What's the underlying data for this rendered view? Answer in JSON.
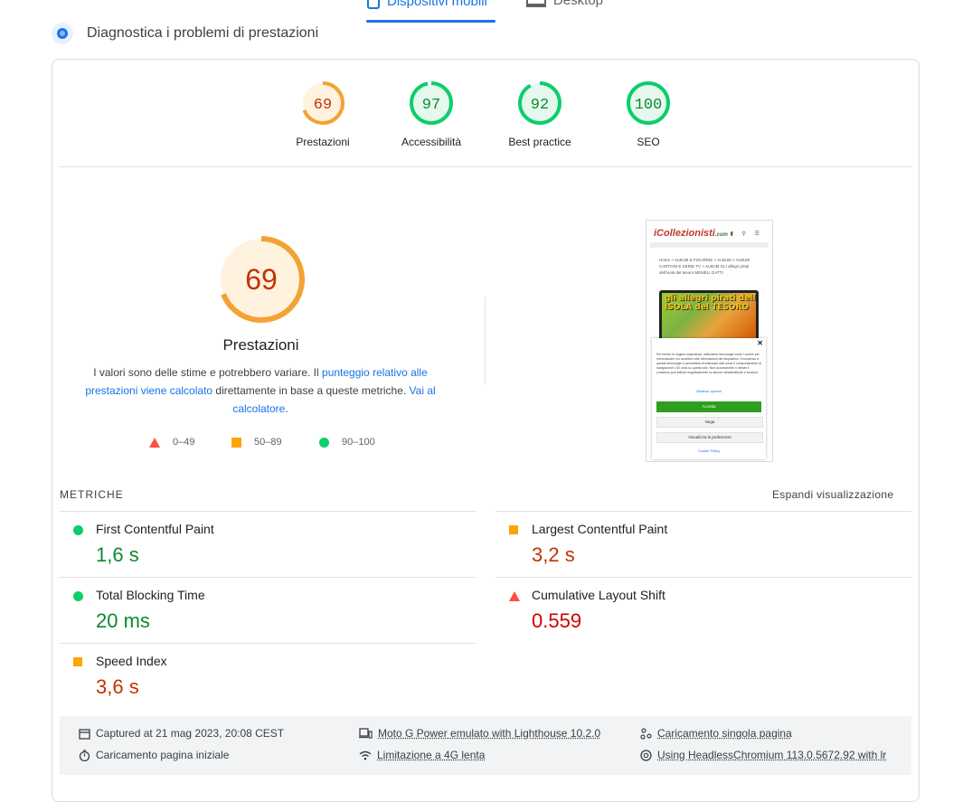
{
  "tabs": {
    "mobile_label": "Dispositivi mobili",
    "desktop_label": "Desktop"
  },
  "diagnostics": {
    "title": "Diagnostica i problemi di prestazioni"
  },
  "gauges": [
    {
      "score": "69",
      "label": "Prestazioni",
      "level": 0.69,
      "color": "#f4a233",
      "text_color": "#c33300",
      "bg": "#fff3e0"
    },
    {
      "score": "97",
      "label": "Accessibilità",
      "level": 0.97,
      "color": "#0cce6b",
      "text_color": "#0d8a2d",
      "bg": "#e6f8ee"
    },
    {
      "score": "92",
      "label": "Best practice",
      "level": 0.92,
      "color": "#0cce6b",
      "text_color": "#0d8a2d",
      "bg": "#e6f8ee"
    },
    {
      "score": "100",
      "label": "SEO",
      "level": 1.0,
      "color": "#0cce6b",
      "text_color": "#0d8a2d",
      "bg": "#e6f8ee"
    }
  ],
  "performance": {
    "score": "69",
    "level": 0.69,
    "title": "Prestazioni",
    "desc_1": "I valori sono delle stime e potrebbero variare. Il ",
    "desc_link_1": "punteggio relativo alle prestazioni viene calcolato",
    "desc_2": " direttamente in base a queste metriche. ",
    "desc_link_2": "Vai al calcolatore",
    "desc_3": "."
  },
  "legend": {
    "bad": "0–49",
    "average": "50–89",
    "good": "90–100"
  },
  "screenshot": {
    "logo_main": "iCollezionisti",
    "logo_suffix": ".com",
    "breadcrumb": "Home > ALBUM & FIGURINE > ALBUM > ALBUM CARTONI E SERIE TV > ALBUM GLI allegri pirati dell'isola del tesoro MEMELI GATTI",
    "image_text": "gli allegri pirati dell ISOLA del TESORO",
    "cookie_text": "Per fornire le migliori esperienze, utilizziamo tecnologie come i cookie per memorizzare e/o accedere alle informazioni del dispositivo. Il consenso a queste tecnologie ci permetterà di elaborare dati come il comportamento di navigazione o ID unici su questo sito. Non acconsentire o ritirare il consenso può influire negativamente su alcune caratteristiche e funzioni.",
    "manage_link": "Gestisci opzioni",
    "accept": "Accetta",
    "deny": "Nega",
    "preferences": "Visualizza le preferenze",
    "policy": "Cookie Policy"
  },
  "metrics": {
    "title": "METRICHE",
    "expand": "Espandi visualizzazione",
    "items": [
      {
        "name": "First Contentful Paint",
        "value": "1,6 s",
        "status": "good"
      },
      {
        "name": "Largest Contentful Paint",
        "value": "3,2 s",
        "status": "average"
      },
      {
        "name": "Total Blocking Time",
        "value": "20 ms",
        "status": "good"
      },
      {
        "name": "Cumulative Layout Shift",
        "value": "0.559",
        "status": "bad"
      },
      {
        "name": "Speed Index",
        "value": "3,6 s",
        "status": "average"
      }
    ]
  },
  "footer": {
    "captured": "Captured at 21 mag 2023, 20:08 CEST",
    "initial_load": "Caricamento pagina iniziale",
    "device": "Moto G Power emulato with Lighthouse 10.2.0",
    "throttling": "Limitazione a 4G lenta",
    "single_load": "Caricamento singola pagina",
    "browser": "Using HeadlessChromium 113.0.5672.92 with lr"
  },
  "colors": {
    "accent": "#1a73e8",
    "good": "#0cce6b",
    "average": "#ffa400",
    "bad": "#ff4e42"
  }
}
